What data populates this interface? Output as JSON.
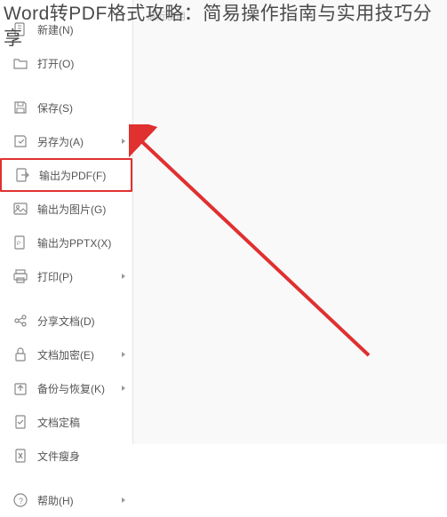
{
  "title": "Word转PDF格式攻略：简易操作指南与实用技巧分享",
  "right_panel": {
    "recent_label": "最近使用"
  },
  "menu": {
    "items": [
      {
        "id": "new",
        "label": "新建(N)",
        "icon": "new-icon",
        "has_arrow": false
      },
      {
        "id": "open",
        "label": "打开(O)",
        "icon": "open-icon",
        "has_arrow": false
      },
      {
        "id": "save",
        "label": "保存(S)",
        "icon": "save-icon",
        "has_arrow": false
      },
      {
        "id": "saveas",
        "label": "另存为(A)",
        "icon": "saveas-icon",
        "has_arrow": true
      },
      {
        "id": "exportpdf",
        "label": "输出为PDF(F)",
        "icon": "pdf-icon",
        "has_arrow": false,
        "highlighted": true
      },
      {
        "id": "exportimg",
        "label": "输出为图片(G)",
        "icon": "image-icon",
        "has_arrow": false
      },
      {
        "id": "exportpptx",
        "label": "输出为PPTX(X)",
        "icon": "pptx-icon",
        "has_arrow": false
      },
      {
        "id": "print",
        "label": "打印(P)",
        "icon": "print-icon",
        "has_arrow": true
      },
      {
        "id": "share",
        "label": "分享文档(D)",
        "icon": "share-icon",
        "has_arrow": false
      },
      {
        "id": "encrypt",
        "label": "文档加密(E)",
        "icon": "encrypt-icon",
        "has_arrow": true
      },
      {
        "id": "backup",
        "label": "备份与恢复(K)",
        "icon": "backup-icon",
        "has_arrow": true
      },
      {
        "id": "docfix",
        "label": "文档定稿",
        "icon": "docfix-icon",
        "has_arrow": false
      },
      {
        "id": "slim",
        "label": "文件瘦身",
        "icon": "slim-icon",
        "has_arrow": false
      },
      {
        "id": "help",
        "label": "帮助(H)",
        "icon": "help-icon",
        "has_arrow": true
      }
    ]
  }
}
